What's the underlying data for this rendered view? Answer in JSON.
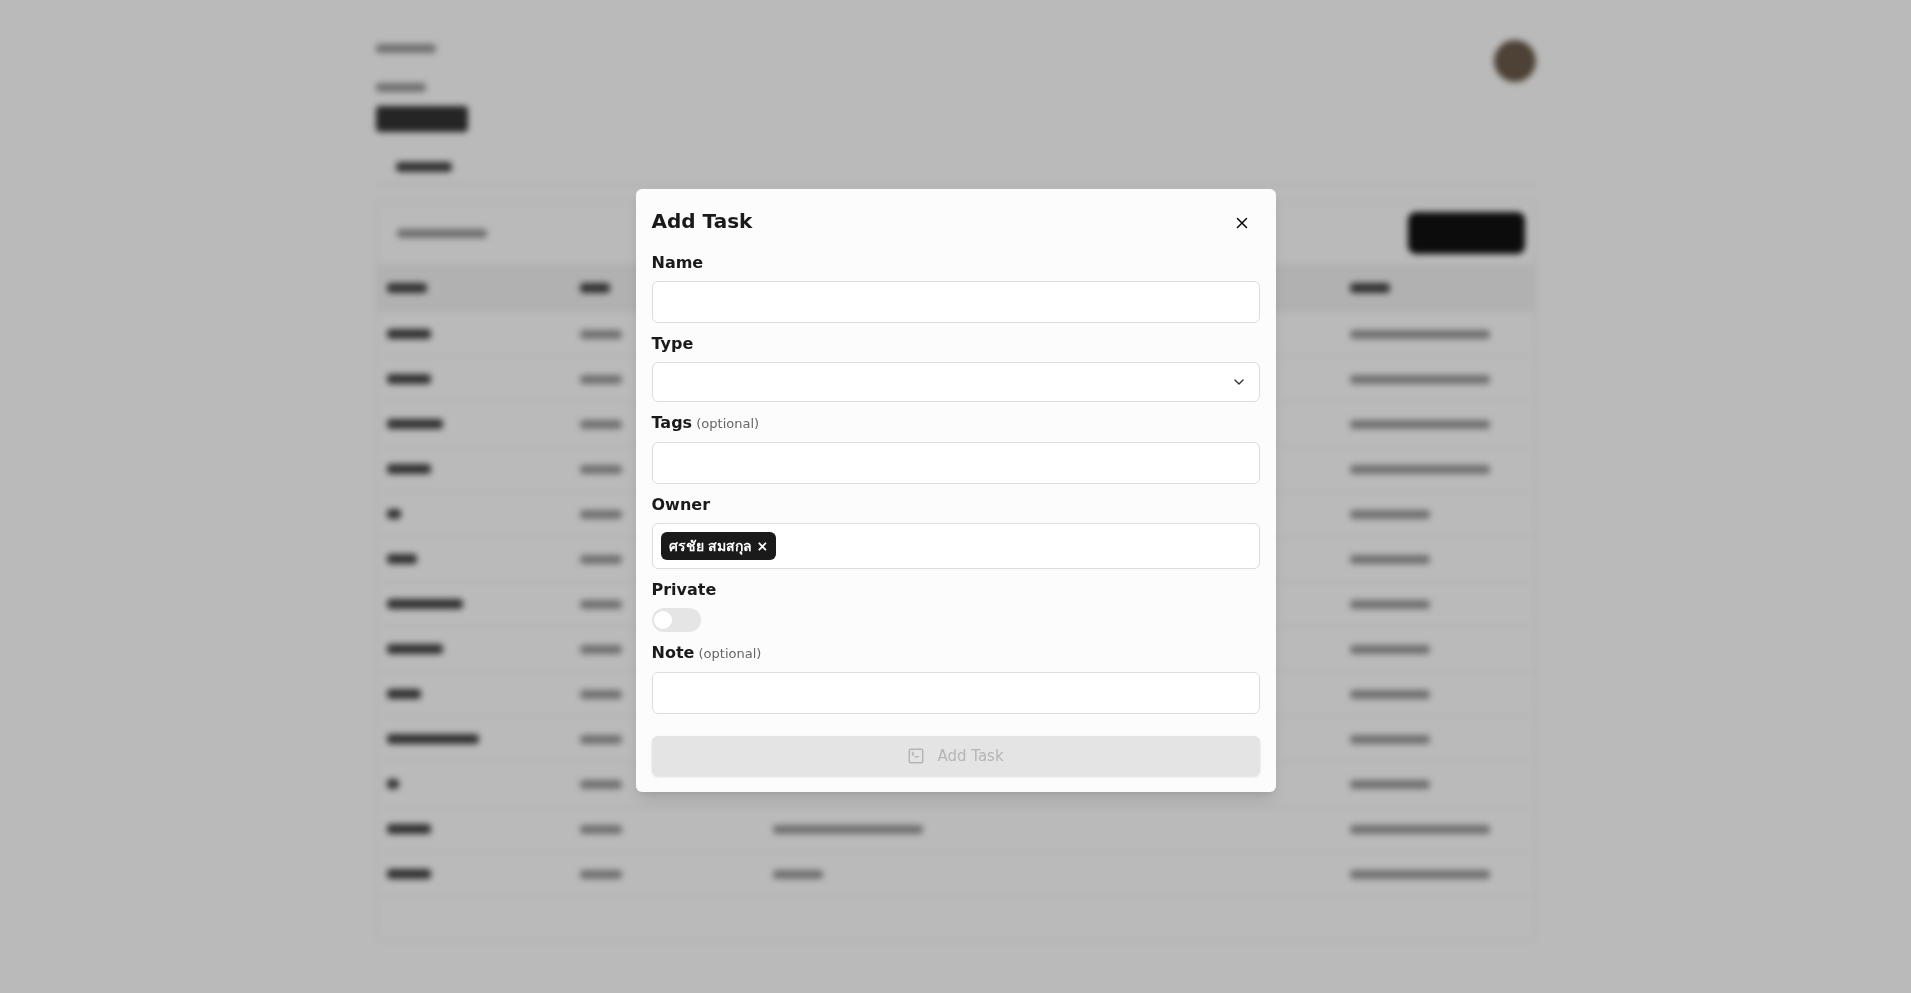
{
  "dialog": {
    "title": "Add Task",
    "fields": [
      {
        "kind": "text",
        "label": "Name"
      },
      {
        "kind": "select",
        "label": "Type"
      },
      {
        "kind": "text",
        "label": "Tags",
        "hint": "(optional)"
      },
      {
        "kind": "chips",
        "label": "Owner",
        "chips": [
          {
            "text": "ศรชัย สมสกุล",
            "remove": "×"
          }
        ]
      },
      {
        "kind": "toggle",
        "label": "Private",
        "on": false
      },
      {
        "kind": "text",
        "label": "Note",
        "hint": "(optional)"
      }
    ],
    "submit": {
      "label": "Add Task",
      "disabled": true
    }
  }
}
